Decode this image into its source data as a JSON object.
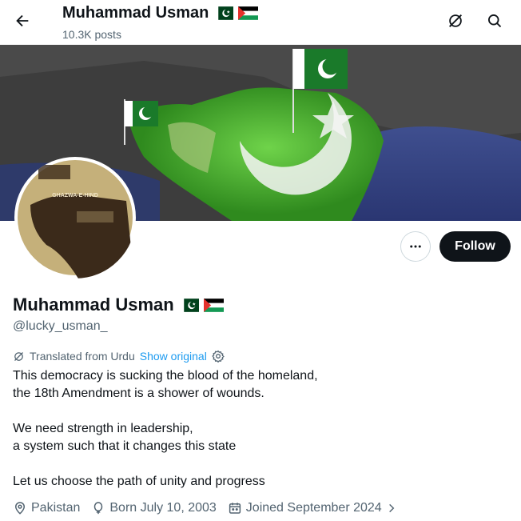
{
  "header": {
    "title": "Muhammad Usman",
    "posts": "10.3K posts"
  },
  "banner": {
    "description": "map with Pakistan flags"
  },
  "avatar": {
    "text": "GHAZWA-E-HIND"
  },
  "actions": {
    "follow_label": "Follow"
  },
  "profile": {
    "name": "Muhammad Usman",
    "handle": "@lucky_usman_",
    "translated_label": "Translated from Urdu",
    "show_original": "Show original",
    "bio_lines": [
      "This democracy is sucking the blood of the homeland,",
      "the 18th Amendment is a shower of wounds.",
      "",
      "We need strength in leadership,",
      "a system such that it changes this state",
      "",
      "Let us choose the path of unity and progress"
    ],
    "location": "Pakistan",
    "birth": "Born July 10, 2003",
    "joined": "Joined September 2024"
  },
  "colors": {
    "accent": "#1d9bf0",
    "text": "#0f1419",
    "secondary": "#536471",
    "pakistan_green": "#01411c"
  }
}
